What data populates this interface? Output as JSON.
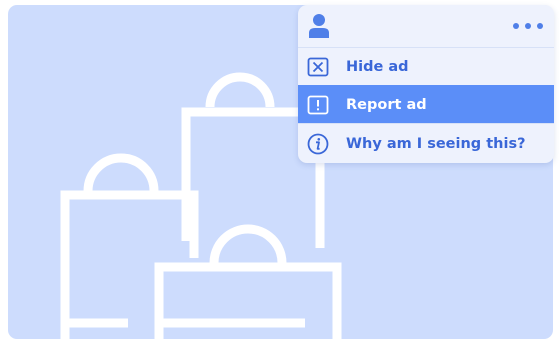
{
  "ad": {
    "background_color": "#cddcfd",
    "illustration": "shopping-bags"
  },
  "menu": {
    "header": {
      "avatar_icon": "user-icon",
      "more_icon": "more-dots-icon"
    },
    "items": [
      {
        "label": "Hide ad",
        "icon": "close-box-icon",
        "active": false
      },
      {
        "label": "Report ad",
        "icon": "exclamation-box-icon",
        "active": true
      },
      {
        "label": "Why am I seeing this?",
        "icon": "info-circle-icon",
        "active": false
      }
    ],
    "accent_color": "#5b8ef8",
    "text_color": "#3a67d8"
  }
}
